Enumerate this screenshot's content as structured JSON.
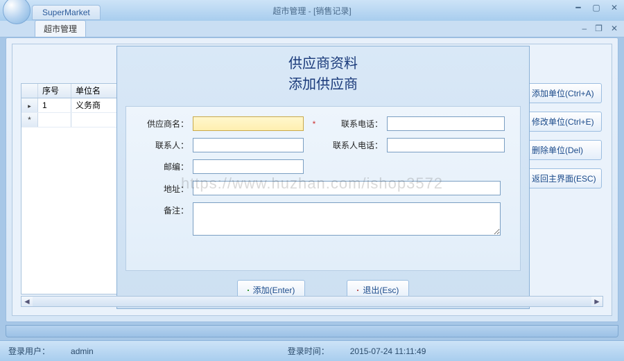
{
  "window": {
    "app_tab": "SuperMarket",
    "title": "超市管理 - [销售记录]",
    "doc_tab": "超市管理"
  },
  "grid": {
    "headers": {
      "col_serial": "序号",
      "col_unit": "单位名"
    },
    "rows": [
      {
        "serial": "1",
        "unit": "义务商"
      }
    ]
  },
  "actions": {
    "add": "添加单位(Ctrl+A)",
    "edit": "修改单位(Ctrl+E)",
    "del": "删除单位(Del)",
    "back": "返回主界面(ESC)"
  },
  "dialog": {
    "title1": "供应商资料",
    "title2": "添加供应商",
    "labels": {
      "supplier_name": "供应商名：",
      "phone": "联系电话：",
      "contact": "联系人：",
      "contact_phone": "联系人电话：",
      "zip": "邮编：",
      "address": "地址：",
      "remark": "备注："
    },
    "values": {
      "supplier_name": "",
      "phone": "",
      "contact": "",
      "contact_phone": "",
      "zip": "",
      "address": "",
      "remark": ""
    },
    "required_mark": "*",
    "buttons": {
      "add": "添加(Enter)",
      "exit": "退出(Esc)"
    }
  },
  "status": {
    "user_label": "登录用户：",
    "user_value": "admin",
    "time_label": "登录时间：",
    "time_value": "2015-07-24 11:11:49"
  },
  "watermark": "https://www.huzhan.com/ishop3572"
}
